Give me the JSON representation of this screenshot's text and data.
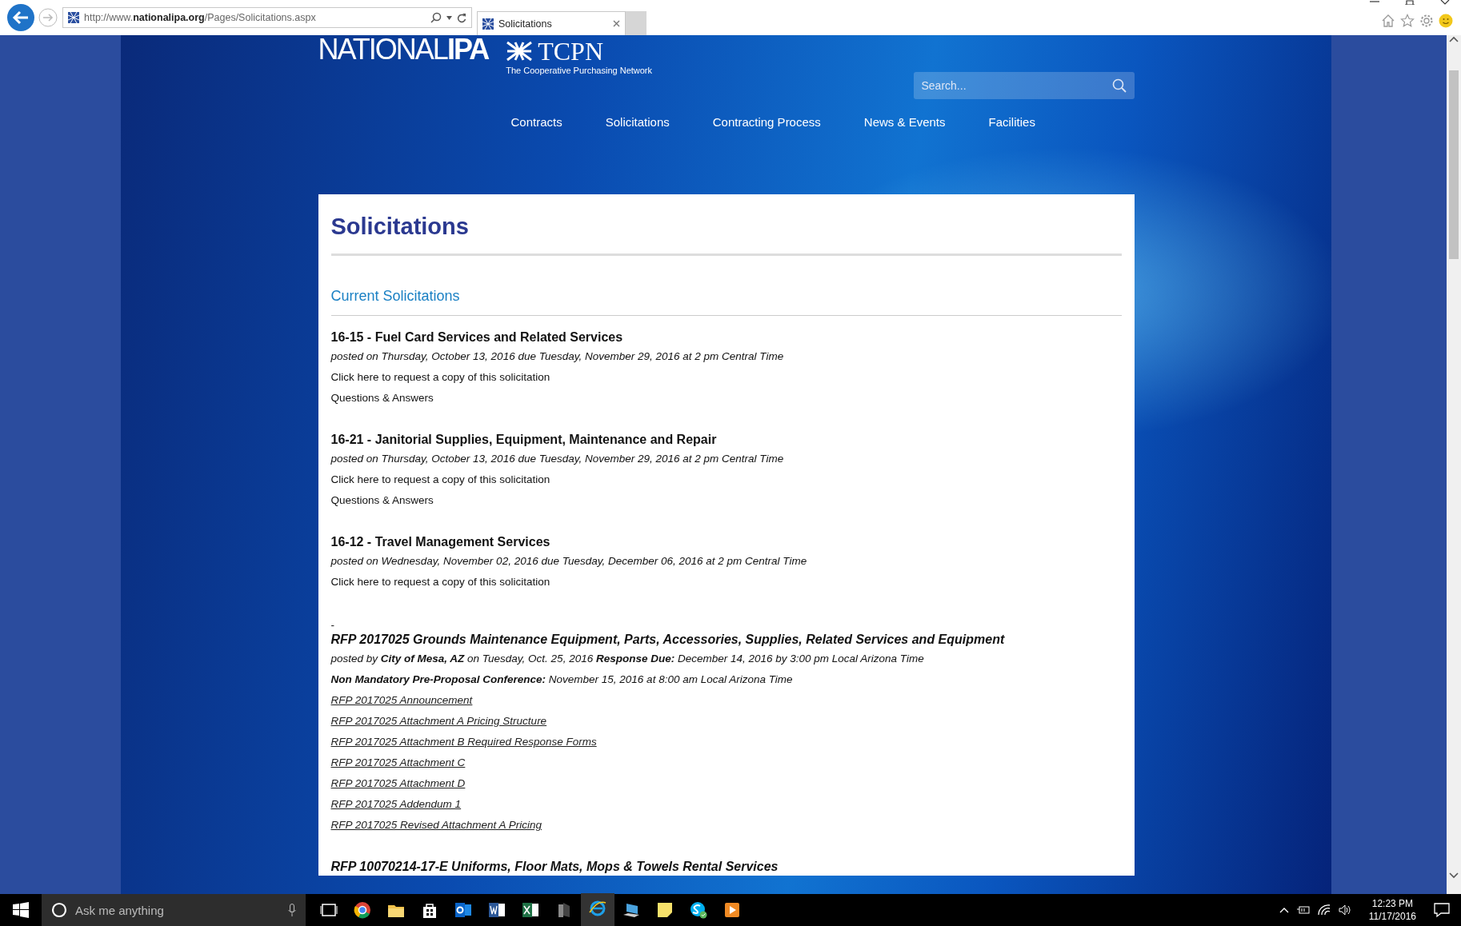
{
  "browser": {
    "url_prefix": "http://www.",
    "url_domain": "nationalipa.org",
    "url_path": "/Pages/Solicitations.aspx",
    "tab_title": "Solicitations"
  },
  "header": {
    "logo": {
      "name_light": "NATIONAL",
      "name_bold": "IPA",
      "partner": "TCPN",
      "tagline": "The Cooperative Purchasing Network"
    },
    "search": {
      "placeholder": "Search..."
    },
    "nav": [
      "Contracts",
      "Solicitations",
      "Contracting Process",
      "News & Events",
      "Facilities"
    ]
  },
  "page": {
    "title": "Solicitations",
    "section": "Current Solicitations",
    "solicitations": [
      {
        "kind": "simple",
        "title": "16-15 - Fuel Card Services and Related Services",
        "posted": "posted on Thursday, October 13, 2016 due Tuesday, November 29, 2016 at 2 pm Central Time",
        "links": [
          "Click here to request a copy of this solicitation",
          "Questions & Answers"
        ]
      },
      {
        "kind": "simple",
        "title": "16-21 - Janitorial Supplies, Equipment, Maintenance and Repair",
        "posted": "posted on Thursday, October 13, 2016 due Tuesday, November 29, 2016 at 2 pm Central Time",
        "links": [
          "Click here to request a copy of this solicitation",
          "Questions & Answers"
        ]
      },
      {
        "kind": "simple",
        "title": "16-12 - Travel Management Services",
        "posted": "posted on Wednesday, November 02, 2016 due Tuesday, December 06, 2016 at 2 pm Central Time",
        "links": [
          "Click here to request a copy of this solicitation"
        ]
      },
      {
        "kind": "rfp",
        "separator": "-",
        "title": "RFP 2017025  Grounds Maintenance Equipment, Parts, Accessories, Supplies, Related Services and Equipment",
        "posted": "posted by **City of Mesa, AZ** on Tuesday, Oct. 25, 2016 **Response Due:** December 14, 2016 by 3:00 pm Local Arizona Time",
        "conference": "**Non Mandatory Pre-Proposal Conference:** November 15, 2016 at 8:00 am Local Arizona Time",
        "documents": [
          "RFP 2017025 Announcement",
          "RFP 2017025 Attachment A Pricing Structure",
          "RFP 2017025 Attachment B Required Response Forms",
          "RFP 2017025 Attachment C",
          "RFP 2017025 Attachment D",
          "RFP 2017025 Addendum 1",
          "RFP 2017025 Revised Attachment A Pricing"
        ]
      },
      {
        "kind": "rfp",
        "title": "RFP 10070214-17-E Uniforms, Floor Mats, Mops & Towels Rental Services"
      }
    ]
  },
  "taskbar": {
    "search_placeholder": "Ask me anything",
    "time": "12:23 PM",
    "date": "11/17/2016"
  }
}
